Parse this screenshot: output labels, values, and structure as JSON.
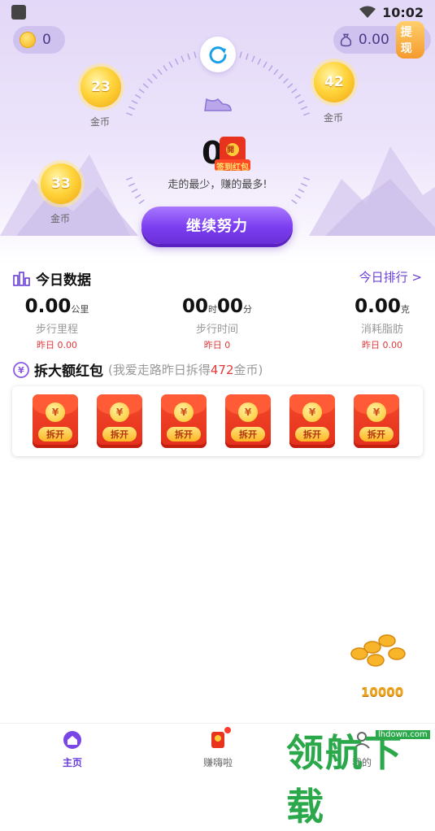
{
  "status_bar": {
    "time": "10:02"
  },
  "top": {
    "coin_balance": "0",
    "cash_balance": "0.00",
    "withdraw_label": "提现"
  },
  "coin_bubbles": [
    {
      "value": "23",
      "label": "金币"
    },
    {
      "value": "42",
      "label": "金币"
    },
    {
      "value": "33",
      "label": "金币"
    }
  ],
  "dial": {
    "steps": "0",
    "badge_label": "签到红包",
    "badge_char": "開",
    "slogan": "走的最少，赚的最多!"
  },
  "continue_label": "继续努力",
  "today": {
    "title": "今日数据",
    "rank_link": "今日排行 >",
    "stats": [
      {
        "value": "0.00",
        "unit": "公里",
        "name": "步行里程",
        "yesterday": "昨日 0.00"
      },
      {
        "value_h": "00",
        "unit_h": "时",
        "value_m": "00",
        "unit_m": "分",
        "name": "步行时间",
        "yesterday": "昨日 0"
      },
      {
        "value": "0.00",
        "unit": "克",
        "name": "消耗脂肪",
        "yesterday": "昨日 0.00"
      }
    ]
  },
  "redpack_section": {
    "title": "拆大额红包",
    "sub_prefix": "(我爱走路昨日拆得",
    "sub_amount": "472",
    "sub_suffix": "金币)",
    "packs": [
      {
        "symbol": "¥",
        "label": "拆开"
      },
      {
        "symbol": "¥",
        "label": "拆开"
      },
      {
        "symbol": "¥",
        "label": "拆开"
      },
      {
        "symbol": "¥",
        "label": "拆开"
      },
      {
        "symbol": "¥",
        "label": "拆开"
      },
      {
        "symbol": "¥",
        "label": "拆开"
      }
    ]
  },
  "float_reward": "10000",
  "tabbar": {
    "home": "主页",
    "earn": "赚嗨啦",
    "mine": "我的"
  },
  "watermark": {
    "text": "领航下载",
    "url": "lhdown.com"
  },
  "colors": {
    "accent": "#6a3fd8",
    "red": "#e03a3a",
    "gold": "#f4b41a"
  }
}
